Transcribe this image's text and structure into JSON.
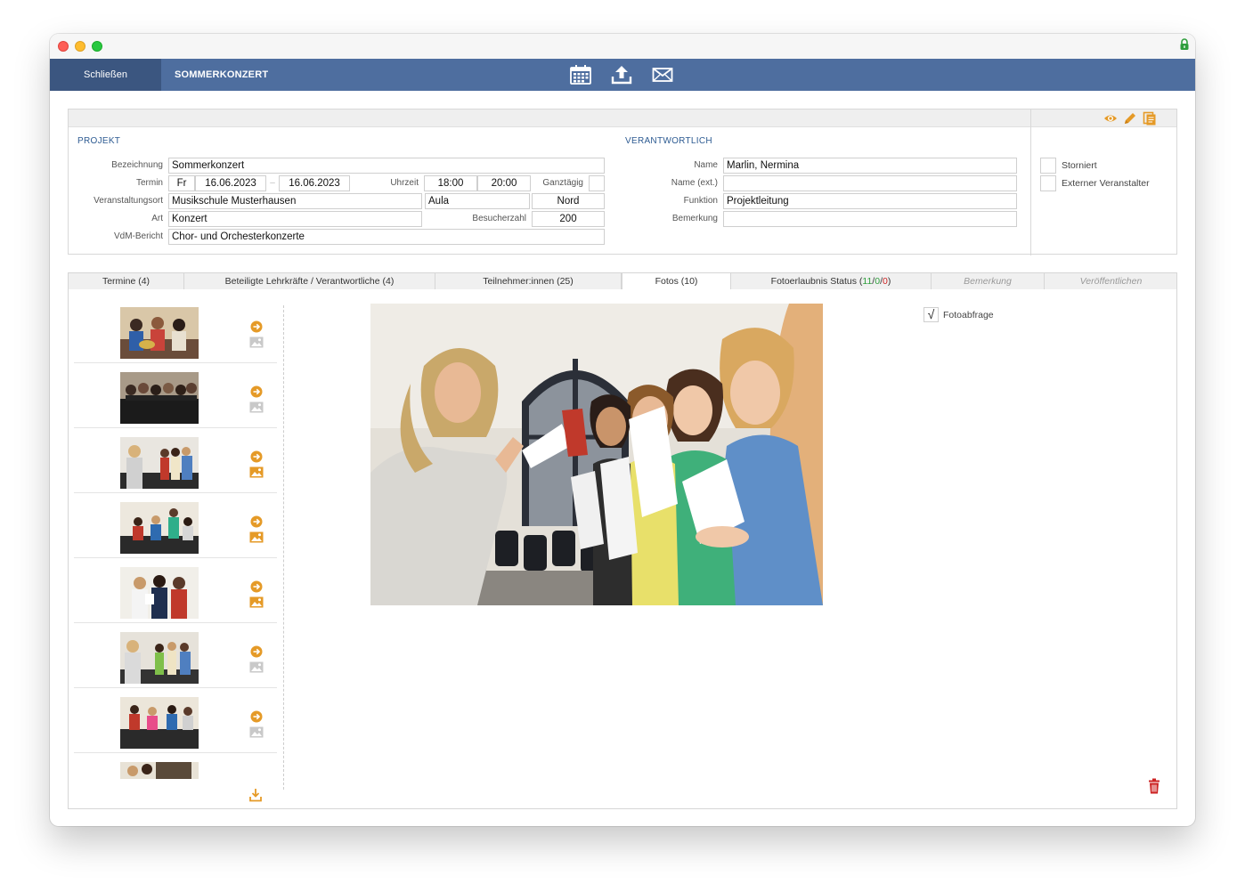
{
  "toolbar": {
    "close_label": "Schließen",
    "title": "SOMMERKONZERT",
    "icons": [
      "calendar-icon",
      "upload-icon",
      "mail-icon"
    ]
  },
  "colors": {
    "header": "#4e6e9f",
    "header_dark": "#3b5680",
    "accent": "#e59a27",
    "section": "#2d5b92",
    "danger": "#cc2222"
  },
  "projekt": {
    "heading": "PROJEKT",
    "bezeichnung_label": "Bezeichnung",
    "bezeichnung": "Sommerkonzert",
    "termin_label": "Termin",
    "weekday": "Fr",
    "date_from": "16.06.2023",
    "date_sep": "–",
    "date_to": "16.06.2023",
    "uhrzeit_label": "Uhrzeit",
    "time_from": "18:00",
    "time_to": "20:00",
    "ganztaegig_label": "Ganztägig",
    "ort_label": "Veranstaltungsort",
    "ort": "Musikschule Musterhausen",
    "raum": "Aula",
    "region": "Nord",
    "art_label": "Art",
    "art": "Konzert",
    "besucher_label": "Besucherzahl",
    "besucher": "200",
    "vdm_label": "VdM-Bericht",
    "vdm": "Chor- und Orchesterkonzerte"
  },
  "verantwortlich": {
    "heading": "VERANTWORTLICH",
    "name_label": "Name",
    "name": "Marlin, Nermina",
    "name_ext_label": "Name (ext.)",
    "name_ext": "",
    "funktion_label": "Funktion",
    "funktion": "Projektleitung",
    "bemerkung_label": "Bemerkung",
    "bemerkung": ""
  },
  "flags": {
    "storniert_label": "Storniert",
    "extern_label": "Externer Veranstalter",
    "storniert": false,
    "extern": false
  },
  "tabs": {
    "termine": "Termine (4)",
    "lehrkraefte": "Beteiligte Lehrkräfte / Verantwortliche (4)",
    "teilnehmer": "Teilnehmer:innen (25)",
    "fotos": "Fotos (10)",
    "fotoerlaubnis_prefix": "Fotoerlaubnis Status (",
    "fotoerlaubnis_green": "11",
    "fotoerlaubnis_mid": "/",
    "fotoerlaubnis_gray": "0",
    "fotoerlaubnis_sep": "/",
    "fotoerlaubnis_red": "0",
    "fotoerlaubnis_suffix": ")",
    "bemerkung": "Bemerkung",
    "veroeffentlichen": "Veröffentlichen",
    "active": "fotos"
  },
  "fotos": {
    "fotoabfrage_label": "Fotoabfrage",
    "fotoabfrage_checked": true,
    "checkmark": "√"
  }
}
